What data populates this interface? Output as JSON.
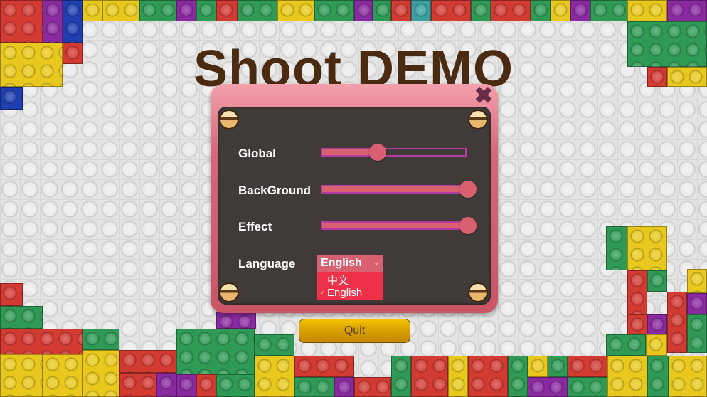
{
  "title": "Shoot DEMO",
  "settings": {
    "close_glyph": "✖",
    "sliders": [
      {
        "label": "Global",
        "value": 0.38
      },
      {
        "label": "BackGround",
        "value": 1.0
      },
      {
        "label": "Effect",
        "value": 1.0
      }
    ],
    "language": {
      "label": "Language",
      "selected": "English",
      "options": [
        "中文",
        "English"
      ]
    }
  },
  "quit_label": "Quit",
  "colors": {
    "panel_pink": "#d86070",
    "panel_dark": "#403a38",
    "dropdown_red": "#ee3148",
    "title_brown": "#4a2a10",
    "quit_gold": "#d8a100"
  }
}
